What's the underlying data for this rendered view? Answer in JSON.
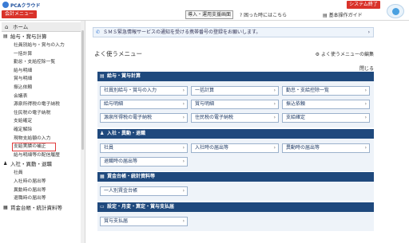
{
  "header": {
    "logo_text": "PCAクラウド",
    "menu_button": "会計メニュー",
    "intro_button": "導入・運用支援画面",
    "help_link": "困った時にはこちら",
    "guide_link": "基本操作ガイド",
    "exit_button": "システム終了"
  },
  "sidebar": {
    "home": "ホーム",
    "sections": [
      {
        "title": "給与・賞与計算",
        "items": [
          "社員別給与・賞与の入力",
          "一括計算",
          "勤怠・支給控除一覧",
          "給与明細",
          "賞与明細",
          "振込依頼",
          "会議表",
          "源泉所得税の電子納税",
          "住民税の電子納税",
          "支給確定",
          "確定解除",
          "現物支給額の入力",
          "支給実績の補正",
          "給与明細等の配信履歴"
        ]
      },
      {
        "title": "入社・異動・退職",
        "items": [
          "社員",
          "入社時の届出等",
          "異動時の届出等",
          "退職時の届出等"
        ]
      },
      {
        "title": "賃金台帳・統計資料等",
        "items": []
      }
    ]
  },
  "notice": {
    "text": "ＳＭＳ緊急情報サービスの通知を受ける携帯番号の登録をお願いします。"
  },
  "favorites": {
    "title": "よく使うメニュー",
    "edit_link": "よく使うメニューの編集",
    "close_link": "閉じる",
    "categories": [
      {
        "title": "給与・賞与計算",
        "buttons": [
          "社員別給与・賞与の入力",
          "一括計算",
          "勤怠・支給控除一覧",
          "給与明細",
          "賞与明細",
          "振込依頼",
          "源泉所得税の電子納税",
          "住民税の電子納税",
          "支給確定"
        ]
      },
      {
        "title": "入社・異動・退職",
        "buttons": [
          "社員",
          "入社時の届出等",
          "異動時の届出等",
          "退職時の届出等"
        ]
      },
      {
        "title": "賃金台帳・統計資料等",
        "buttons": [
          "一人別賃金台帳"
        ]
      },
      {
        "title": "設定・月変・算定・賞与支払届",
        "buttons": [
          "賞与支払届"
        ]
      }
    ]
  }
}
